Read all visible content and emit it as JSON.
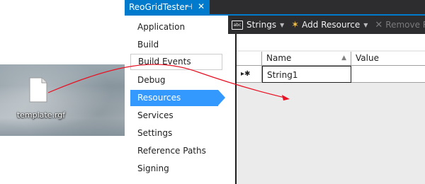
{
  "desktop": {
    "file_label": "template.rgf"
  },
  "window": {
    "tab_title": "ReoGridTester",
    "pin_glyph": "⊣",
    "close_glyph": "✕"
  },
  "nav": {
    "items": [
      {
        "label": "Application"
      },
      {
        "label": "Build"
      },
      {
        "label": "Build Events"
      },
      {
        "label": "Debug"
      },
      {
        "label": "Resources"
      },
      {
        "label": "Services"
      },
      {
        "label": "Settings"
      },
      {
        "label": "Reference Paths"
      },
      {
        "label": "Signing"
      }
    ],
    "active_label": "Resources"
  },
  "toolbar": {
    "strings_label": "Strings",
    "add_label": "Add Resource",
    "remove_label": "Remove Res"
  },
  "grid": {
    "columns": {
      "name": "Name",
      "value": "Value"
    },
    "row_marker": "▸✱",
    "rows": [
      {
        "name": "String1",
        "value": ""
      }
    ]
  },
  "colors": {
    "accent": "#007acc",
    "selection": "#3399ff",
    "arrow": "#e81123"
  }
}
